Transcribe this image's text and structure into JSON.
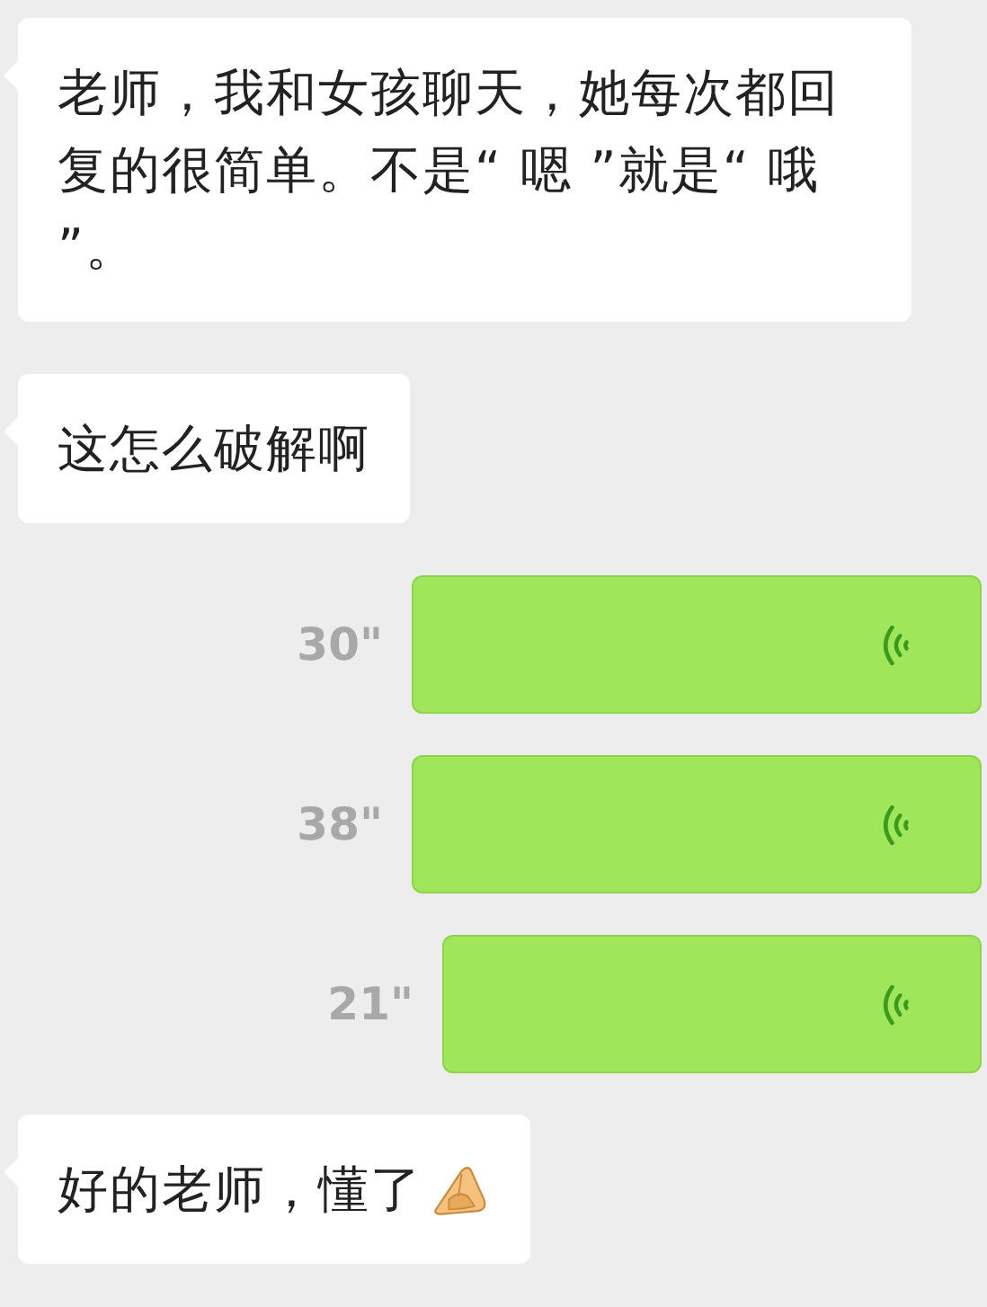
{
  "messages": [
    {
      "kind": "text",
      "outgoing": false,
      "text": "老师，我和女孩聊天，她每次都回复的很简单。不是“ 嗯 ”就是“ 哦 ”。"
    },
    {
      "kind": "text",
      "outgoing": false,
      "text": "这怎么破解啊"
    },
    {
      "kind": "voice",
      "outgoing": true,
      "duration": "30\""
    },
    {
      "kind": "voice",
      "outgoing": true,
      "duration": "38\""
    },
    {
      "kind": "voice",
      "outgoing": true,
      "duration": "21\""
    },
    {
      "kind": "text_emoji",
      "outgoing": false,
      "text": "好的老师，懂了"
    }
  ]
}
